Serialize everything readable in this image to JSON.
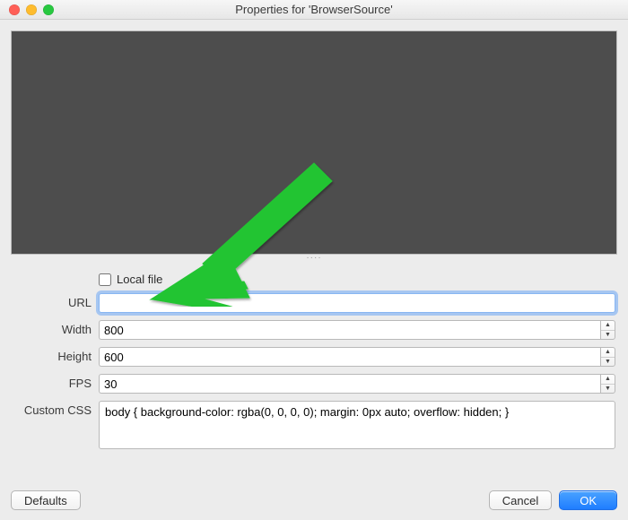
{
  "window": {
    "title": "Properties for 'BrowserSource'"
  },
  "form": {
    "local_file": {
      "label": "Local file",
      "checked": false
    },
    "url": {
      "label": "URL",
      "value": "",
      "placeholder": ""
    },
    "width": {
      "label": "Width",
      "value": "800"
    },
    "height": {
      "label": "Height",
      "value": "600"
    },
    "fps": {
      "label": "FPS",
      "value": "30"
    },
    "custom_css": {
      "label": "Custom CSS",
      "value": "body { background-color: rgba(0, 0, 0, 0); margin: 0px auto; overflow: hidden; }"
    }
  },
  "buttons": {
    "defaults": "Defaults",
    "cancel": "Cancel",
    "ok": "OK"
  },
  "annotation": {
    "arrow_color": "#22c431"
  }
}
